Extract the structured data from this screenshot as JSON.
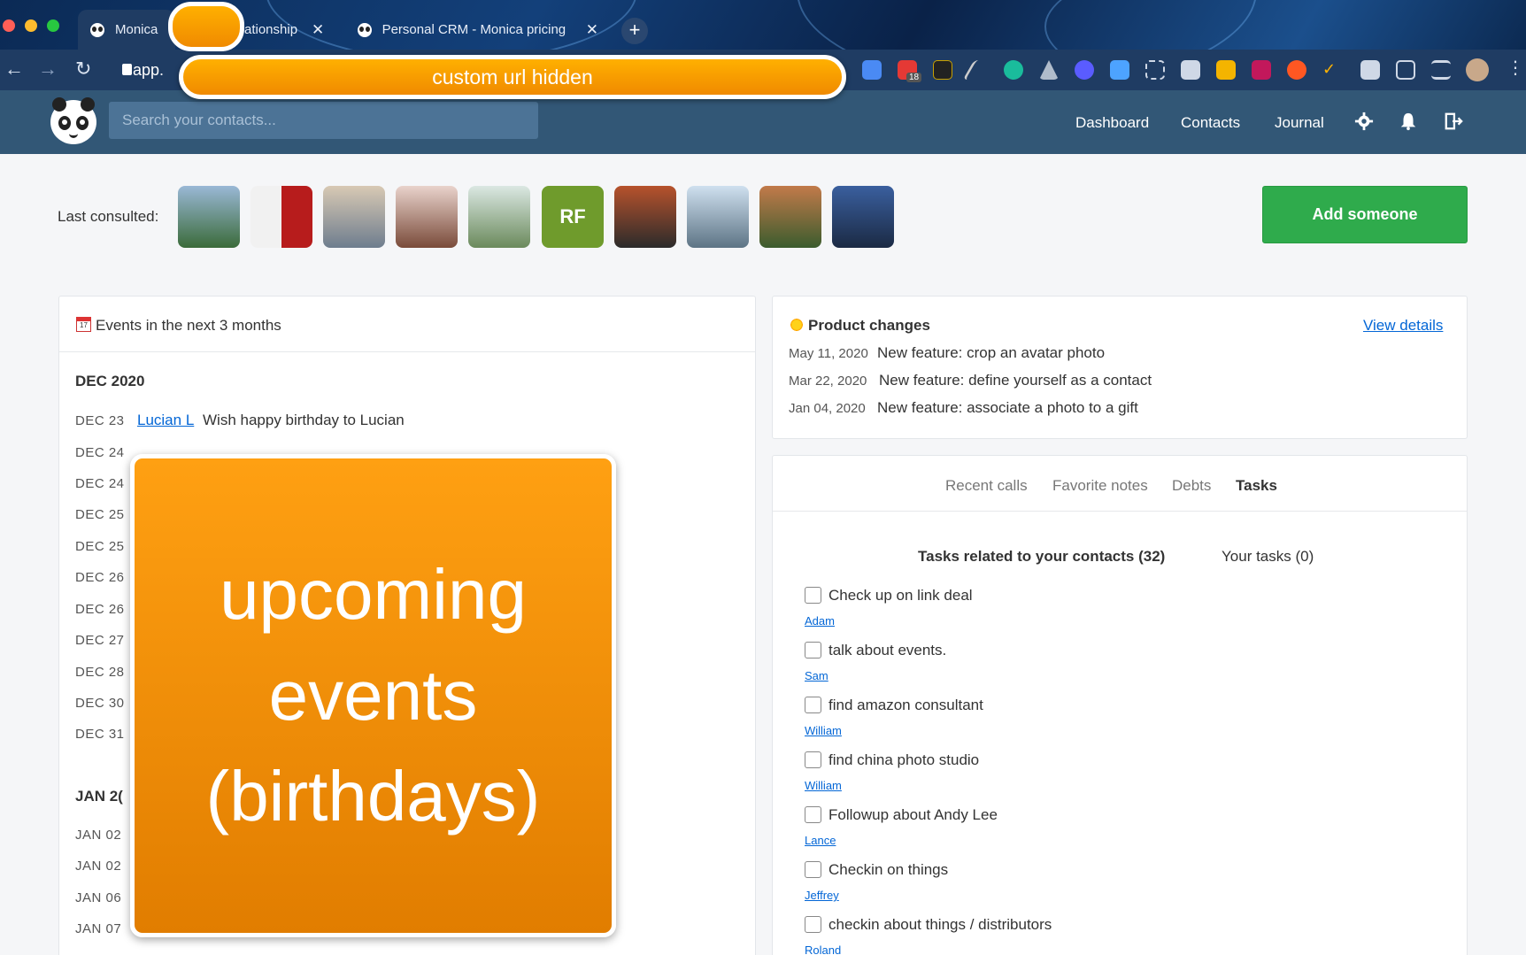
{
  "browser": {
    "tabs": [
      {
        "label": "Monica",
        "active": true
      },
      {
        "label": "ationship",
        "active": false
      },
      {
        "label": "Personal CRM - Monica pricing",
        "active": false
      }
    ],
    "new_tab": "+",
    "url_visible": "app.",
    "url_mask_label": "custom url hidden",
    "extension_badge": "18"
  },
  "header": {
    "search_placeholder": "Search your contacts...",
    "nav": [
      "Dashboard",
      "Contacts",
      "Journal"
    ]
  },
  "last_consulted": {
    "label": "Last consulted:",
    "initials_avatar": "RF",
    "add_button": "Add someone"
  },
  "events": {
    "title": "Events in the next 3 months",
    "calendar_icon_text": "17",
    "months": [
      "DEC 2020",
      "JAN 2("
    ],
    "rows": [
      {
        "date": "DEC 23",
        "contact": "Lucian L",
        "text": "Wish happy birthday to Lucian"
      },
      {
        "date": "DEC 24"
      },
      {
        "date": "DEC 24"
      },
      {
        "date": "DEC 25"
      },
      {
        "date": "DEC 25"
      },
      {
        "date": "DEC 26"
      },
      {
        "date": "DEC 26"
      },
      {
        "date": "DEC 27"
      },
      {
        "date": "DEC 28"
      },
      {
        "date": "DEC 30"
      },
      {
        "date": "DEC 31"
      },
      {
        "date": "JAN 02"
      },
      {
        "date": "JAN 02"
      },
      {
        "date": "JAN 06"
      },
      {
        "date": "JAN 07"
      }
    ],
    "overlay_lines": [
      "upcoming",
      "events",
      "(birthdays)"
    ]
  },
  "product_changes": {
    "title": "Product changes",
    "link": "View details",
    "items": [
      {
        "date": "May 11, 2020",
        "text": "New feature: crop an avatar photo"
      },
      {
        "date": "Mar 22, 2020",
        "text": "New feature: define yourself as a contact"
      },
      {
        "date": "Jan 04, 2020",
        "text": "New feature: associate a photo to a gift"
      }
    ]
  },
  "tasks_panel": {
    "tabs": [
      "Recent calls",
      "Favorite notes",
      "Debts",
      "Tasks"
    ],
    "active_tab": "Tasks",
    "subtabs": [
      "Tasks related to your contacts (32)",
      "Your tasks (0)"
    ],
    "tasks": [
      {
        "text": "Check up on link deal",
        "contact": "Adam"
      },
      {
        "text": "talk about events.",
        "contact": "Sam"
      },
      {
        "text": "find amazon consultant",
        "contact": "William"
      },
      {
        "text": "find china photo studio",
        "contact": "William"
      },
      {
        "text": "Followup about Andy Lee",
        "contact": "Lance"
      },
      {
        "text": "Checkin on things",
        "contact": "Jeffrey"
      },
      {
        "text": "checkin about things / distributors",
        "contact": "Roland"
      }
    ]
  },
  "colors": {
    "header": "#325776",
    "add_button": "#2fab4c",
    "link": "#0366d6",
    "overlay": "#f39200"
  }
}
